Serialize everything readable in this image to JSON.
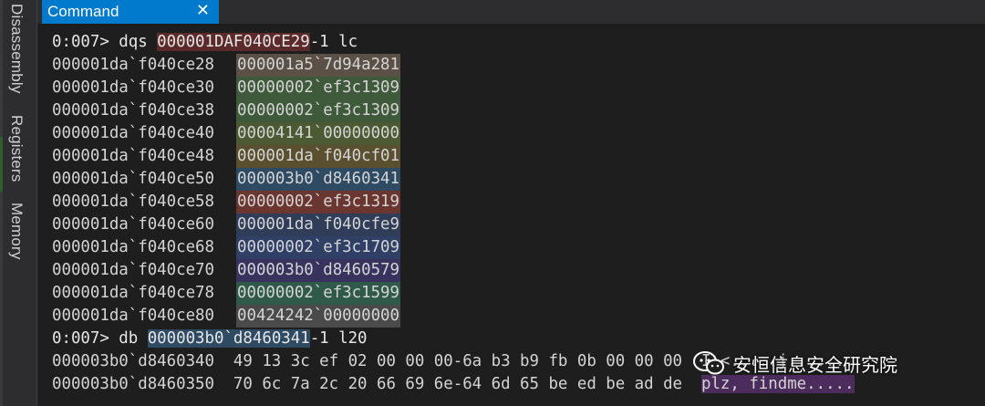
{
  "side_tabs": [
    "Disassembly",
    "Registers",
    "Memory"
  ],
  "window": {
    "tab_label": "Command",
    "close_glyph": "✕"
  },
  "console": {
    "cmd1": {
      "prompt": "0:007> dqs ",
      "addr": "000001DAF040CE29",
      "suffix": "-1 lc"
    },
    "rows": [
      {
        "addr": "000001da`f040ce28",
        "value": "000001a5`7d94a281",
        "color": "#5a5046"
      },
      {
        "addr": "000001da`f040ce30",
        "value": "00000002`ef3c1309",
        "color": "#3f5a3a"
      },
      {
        "addr": "000001da`f040ce38",
        "value": "00000002`ef3c1309",
        "color": "#3f5a3a"
      },
      {
        "addr": "000001da`f040ce40",
        "value": "00004141`00000000",
        "color": "#4b5a33"
      },
      {
        "addr": "000001da`f040ce48",
        "value": "000001da`f040cf01",
        "color": "#5a5030"
      },
      {
        "addr": "000001da`f040ce50",
        "value": "000003b0`d8460341",
        "color": "#2f4a63"
      },
      {
        "addr": "000001da`f040ce58",
        "value": "00000002`ef3c1319",
        "color": "#6b3530"
      },
      {
        "addr": "000001da`f040ce60",
        "value": "000001da`f040cfe9",
        "color": "#2f3d58"
      },
      {
        "addr": "000001da`f040ce68",
        "value": "00000002`ef3c1709",
        "color": "#2f3f66"
      },
      {
        "addr": "000001da`f040ce70",
        "value": "000003b0`d8460579",
        "color": "#38335e"
      },
      {
        "addr": "000001da`f040ce78",
        "value": "00000002`ef3c1599",
        "color": "#2f5a4a"
      },
      {
        "addr": "000001da`f040ce80",
        "value": "00424242`00000000",
        "color": "#4a4a4a"
      }
    ],
    "cmd2": {
      "prompt": "0:007> db ",
      "addr": "000003b0`d8460341",
      "suffix": "-1 l20"
    },
    "dump": [
      {
        "text": "000003b0`d8460340  49 13 3c ef 02 00 00 00-6a b3 b9 fb 0b 00 00 00  I.<.....j.......",
        "ascii_hl": ""
      },
      {
        "text": "000003b0`d8460350  70 6c 7a 2c 20 66 69 6e-64 6d 65 be ed be ad de  ",
        "ascii_hl": "plz, findme....."
      }
    ]
  },
  "watermark": {
    "text": "安恒信息安全研究院"
  }
}
